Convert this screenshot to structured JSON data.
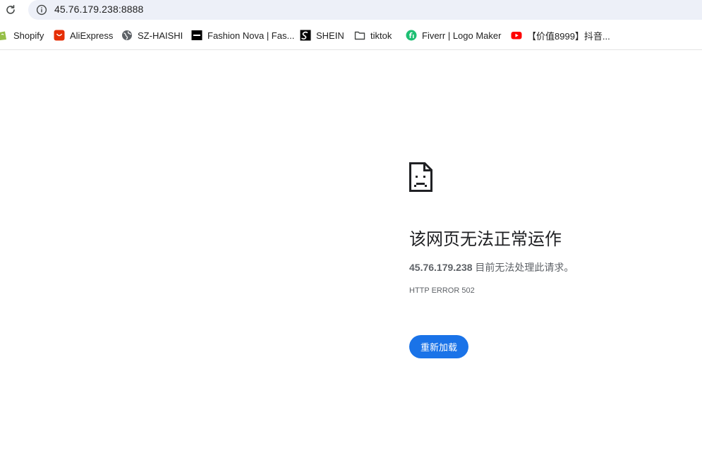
{
  "address_bar": {
    "url": "45.76.179.238:8888"
  },
  "bookmarks": [
    {
      "label": "Shopify",
      "icon": "shopify-icon"
    },
    {
      "label": "AliExpress",
      "icon": "aliexpress-icon"
    },
    {
      "label": "SZ-HAISHI",
      "icon": "globe-icon"
    },
    {
      "label": "Fashion Nova | Fas...",
      "icon": "fashion-nova-icon"
    },
    {
      "label": "SHEIN",
      "icon": "shein-icon"
    },
    {
      "label": "tiktok",
      "icon": "folder-icon"
    },
    {
      "label": "Fiverr | Logo Maker",
      "icon": "fiverr-icon"
    },
    {
      "label": "【价值8999】抖音...",
      "icon": "youtube-icon"
    }
  ],
  "error": {
    "title": "该网页无法正常运作",
    "host": "45.76.179.238",
    "message": " 目前无法处理此请求。",
    "code": "HTTP ERROR 502",
    "reload_label": "重新加载"
  },
  "colors": {
    "primary_button": "#1a73e8",
    "omnibox_bg": "#edf0f8",
    "text_secondary": "#5f6368"
  }
}
